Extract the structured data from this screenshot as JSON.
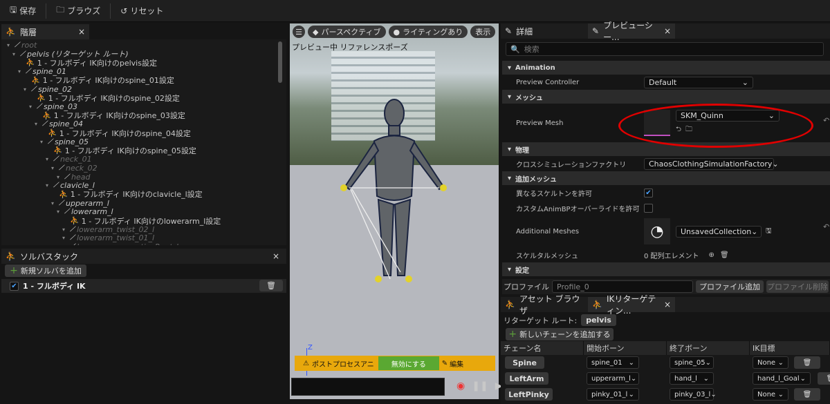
{
  "toolbar": {
    "save": "保存",
    "browse": "ブラウズ",
    "reset": "リセット"
  },
  "hierarchy": {
    "tab": "階層",
    "rows": [
      {
        "text": "root",
        "level": 0,
        "kind": "bone",
        "dim": true
      },
      {
        "text": "pelvis (リターゲット ルート)",
        "level": 1,
        "kind": "bone"
      },
      {
        "text": "1 - フルボディ IK向けのpelvis設定",
        "level": 2,
        "kind": "ik"
      },
      {
        "text": "spine_01",
        "level": 2,
        "kind": "bone"
      },
      {
        "text": "1 - フルボディ IK向けのspine_01設定",
        "level": 3,
        "kind": "ik"
      },
      {
        "text": "spine_02",
        "level": 3,
        "kind": "bone"
      },
      {
        "text": "1 - フルボディ IK向けのspine_02設定",
        "level": 4,
        "kind": "ik"
      },
      {
        "text": "spine_03",
        "level": 4,
        "kind": "bone"
      },
      {
        "text": "1 - フルボディ IK向けのspine_03設定",
        "level": 5,
        "kind": "ik"
      },
      {
        "text": "spine_04",
        "level": 5,
        "kind": "bone"
      },
      {
        "text": "1 - フルボディ IK向けのspine_04設定",
        "level": 6,
        "kind": "ik"
      },
      {
        "text": "spine_05",
        "level": 6,
        "kind": "bone"
      },
      {
        "text": "1 - フルボディ IK向けのspine_05設定",
        "level": 7,
        "kind": "ik"
      },
      {
        "text": "neck_01",
        "level": 7,
        "kind": "bone",
        "dim": true
      },
      {
        "text": "neck_02",
        "level": 8,
        "kind": "bone",
        "dim": true
      },
      {
        "text": "head",
        "level": 9,
        "kind": "bone",
        "dim": true
      },
      {
        "text": "clavicle_l",
        "level": 7,
        "kind": "bone"
      },
      {
        "text": "1 - フルボディ IK向けのclavicle_l設定",
        "level": 8,
        "kind": "ik"
      },
      {
        "text": "upperarm_l",
        "level": 8,
        "kind": "bone"
      },
      {
        "text": "lowerarm_l",
        "level": 9,
        "kind": "bone"
      },
      {
        "text": "1 - フルボディ IK向けのlowerarm_l設定",
        "level": 10,
        "kind": "ik"
      },
      {
        "text": "lowerarm_twist_02_l",
        "level": 10,
        "kind": "bone",
        "dim": true
      },
      {
        "text": "lowerarm_twist_01_l",
        "level": 10,
        "kind": "bone",
        "dim": true
      },
      {
        "text": "lowerarm_correctiveRoot_l",
        "level": 10,
        "kind": "bone",
        "dim": true
      }
    ]
  },
  "solver": {
    "tab": "ソルバスタック",
    "add": "新規ソルバを追加",
    "item": "1 - フルボディ IK"
  },
  "viewport": {
    "perspective": "パースペクティブ",
    "lighting": "ライティングあり",
    "show": "表示",
    "label": "プレビュー中 リファレンスポーズ",
    "axis": "Z",
    "post": "ポストプロセスアニ",
    "disable": "無効にする",
    "edit": "編集"
  },
  "details": {
    "tab1": "詳細",
    "tab2": "プレビューシー...",
    "search": "検索",
    "sec_anim": "Animation",
    "preview_controller": "Preview Controller",
    "default": "Default",
    "sec_mesh": "メッシュ",
    "preview_mesh": "Preview Mesh",
    "mesh_value": "SKM_Quinn",
    "sec_phys": "物理",
    "cloth": "クロスシミュレーションファクトリ",
    "cloth_value": "ChaosClothingSimulationFactory",
    "sec_add": "追加メッシュ",
    "allow_skel": "異なるスケルトンを許可",
    "allow_anim": "カスタムAnimBPオーバーライドを許可",
    "additional": "Additional Meshes",
    "collection": "UnsavedCollection",
    "skel_mesh": "スケルタルメッシュ",
    "skel_count": "0 配列エレメント",
    "sec_set": "設定",
    "profile": "プロファイル",
    "profile_value": "Profile_0",
    "profile_add": "プロファイル追加",
    "profile_del": "プロファイル削除"
  },
  "bottom": {
    "tab1": "アセット ブラウザ",
    "tab2": "IKリターゲティン...",
    "root_label": "リターゲット ルート:",
    "root_value": "pelvis",
    "add_chain": "新しいチェーンを追加する",
    "headers": [
      "チェーン名",
      "開始ボーン",
      "終了ボーン",
      "IK目標"
    ],
    "rows": [
      {
        "name": "Spine",
        "start": "spine_01",
        "end": "spine_05",
        "goal": "None"
      },
      {
        "name": "LeftArm",
        "start": "upperarm_l",
        "end": "hand_l",
        "goal": "hand_l_Goal"
      },
      {
        "name": "LeftPinky",
        "start": "pinky_01_l",
        "end": "pinky_03_l",
        "goal": "None"
      }
    ]
  },
  "colors": {
    "accent": "#e8a80c",
    "ik_green": "#5c9e3a",
    "annotation": "#e00000"
  }
}
